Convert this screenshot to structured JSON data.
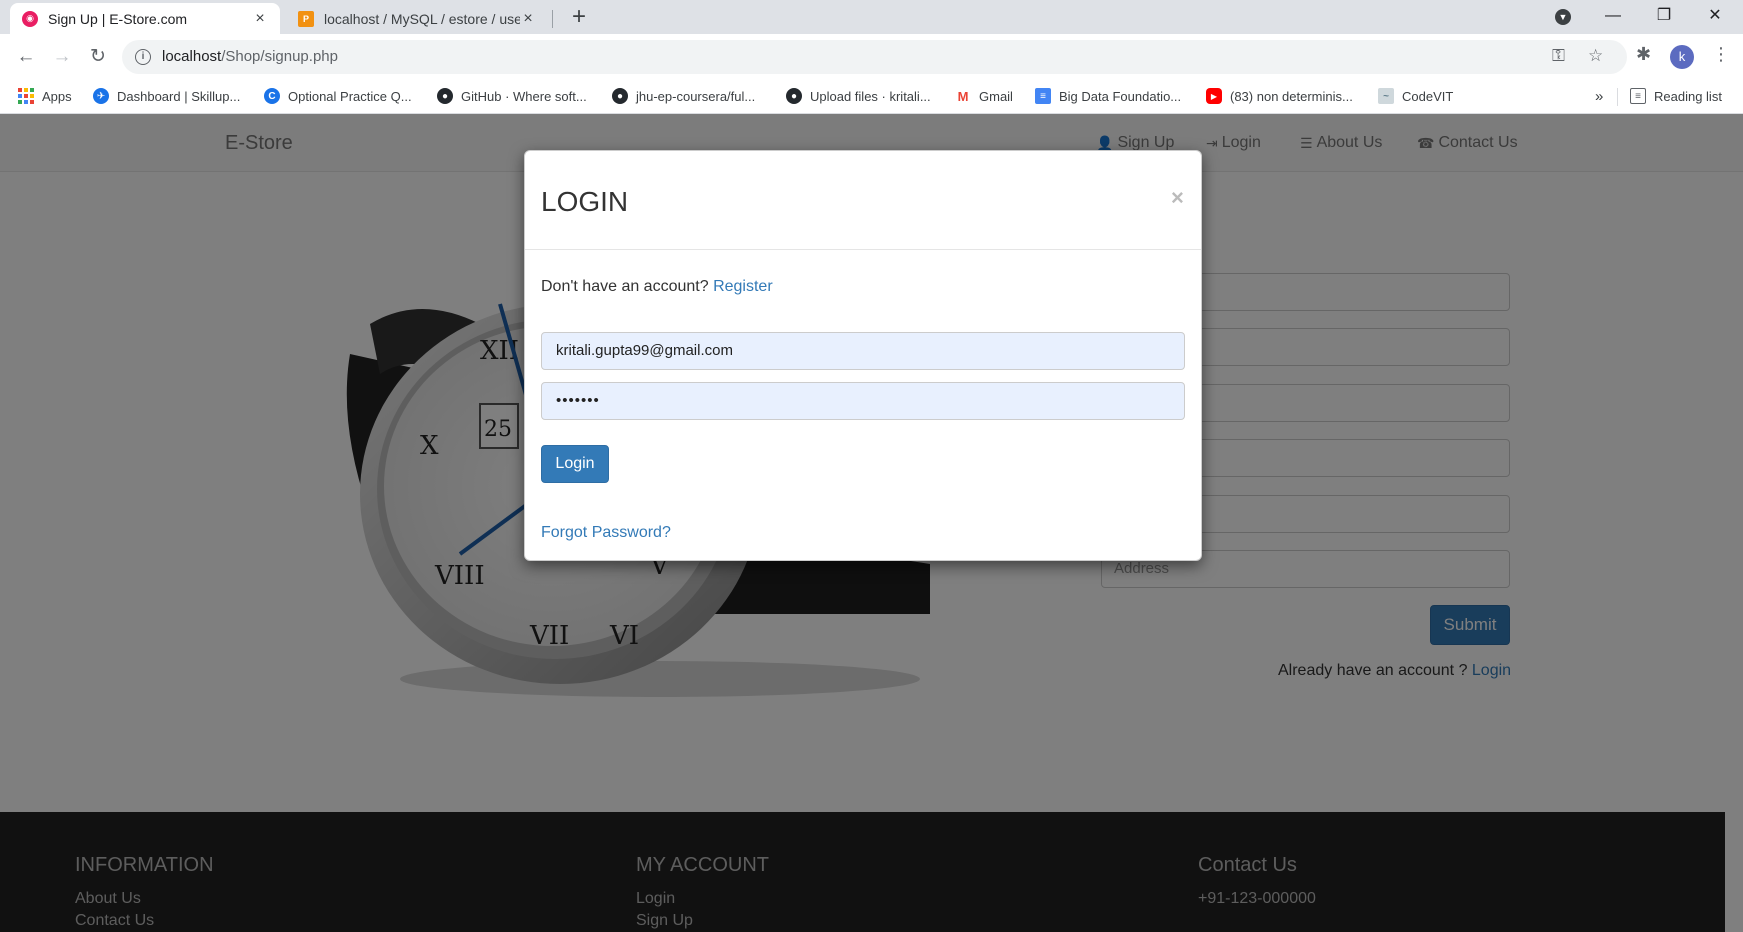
{
  "browser": {
    "tabs": [
      {
        "title": "Sign Up | E-Store.com",
        "active": true
      },
      {
        "title": "localhost / MySQL / estore / user",
        "active": false
      }
    ],
    "url_host": "localhost",
    "url_path": "/Shop/signup.php",
    "avatar_letter": "k",
    "reading_list": "Reading list",
    "bookmarks": [
      {
        "label": "Apps",
        "icon": "apps-grid-icon"
      },
      {
        "label": "Dashboard | Skillup...",
        "icon": "skillup-icon"
      },
      {
        "label": "Optional Practice Q...",
        "icon": "google-c-icon"
      },
      {
        "label": "GitHub · Where soft...",
        "icon": "github-icon"
      },
      {
        "label": "jhu-ep-coursera/ful...",
        "icon": "github-icon"
      },
      {
        "label": "Upload files · kritali...",
        "icon": "github-icon"
      },
      {
        "label": "Gmail",
        "icon": "gmail-icon"
      },
      {
        "label": "Big Data Foundatio...",
        "icon": "docs-icon"
      },
      {
        "label": "(83) non determinis...",
        "icon": "youtube-icon"
      },
      {
        "label": "CodeVIT",
        "icon": "codevit-icon"
      }
    ]
  },
  "site": {
    "brand": "E-Store",
    "nav": [
      {
        "label": "Sign Up",
        "icon": "user-icon"
      },
      {
        "label": "Login",
        "icon": "login-icon"
      },
      {
        "label": "About Us",
        "icon": "list-icon"
      },
      {
        "label": "Contact Us",
        "icon": "phone-icon"
      }
    ],
    "signup_title_visible": "UP",
    "address_placeholder": "Address",
    "submit_label": "Submit",
    "already_text": "Already have an account ? ",
    "already_link": "Login"
  },
  "footer": {
    "information": {
      "heading": "INFORMATION",
      "items": [
        "About Us",
        "Contact Us"
      ]
    },
    "account": {
      "heading": "MY ACCOUNT",
      "items": [
        "Login",
        "Sign Up"
      ]
    },
    "contact": {
      "heading": "Contact Us",
      "items": [
        "+91-123-000000"
      ]
    }
  },
  "modal": {
    "title": "LOGIN",
    "close": "×",
    "no_account_text": "Don't have an account? ",
    "register_link": "Register",
    "email_value": "kritali.gupta99@gmail.com",
    "password_value": "•••••••",
    "login_label": "Login",
    "forgot_label": "Forgot Password?"
  },
  "colors": {
    "accent": "#337ab7",
    "footer_bg": "#222222"
  }
}
